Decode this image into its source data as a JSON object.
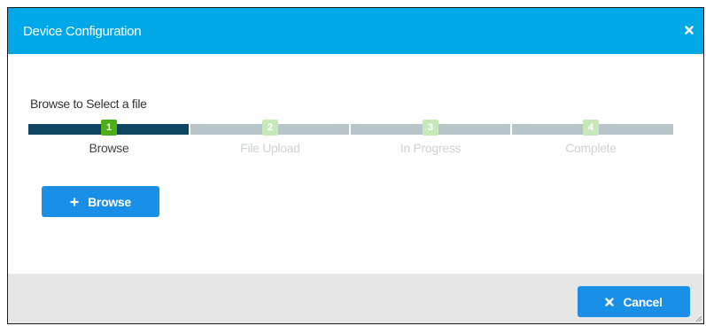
{
  "dialog": {
    "title": "Device Configuration",
    "close_icon": "close-icon"
  },
  "instruction": "Browse to Select a file",
  "steps": [
    {
      "number": "1",
      "label": "Browse",
      "active": true
    },
    {
      "number": "2",
      "label": "File Upload",
      "active": false
    },
    {
      "number": "3",
      "label": "In Progress",
      "active": false
    },
    {
      "number": "4",
      "label": "Complete",
      "active": false
    }
  ],
  "browse_button": {
    "label": "Browse",
    "icon": "plus-icon"
  },
  "cancel_button": {
    "label": "Cancel",
    "icon": "close-icon"
  },
  "colors": {
    "titlebar": "#00a8e8",
    "button": "#1a8fe8",
    "active_segment": "#0f4560",
    "inactive_segment": "#b7c4ca",
    "active_badge": "#4caf18",
    "inactive_badge": "#c7e8b8",
    "footer": "#e6e6e6"
  }
}
